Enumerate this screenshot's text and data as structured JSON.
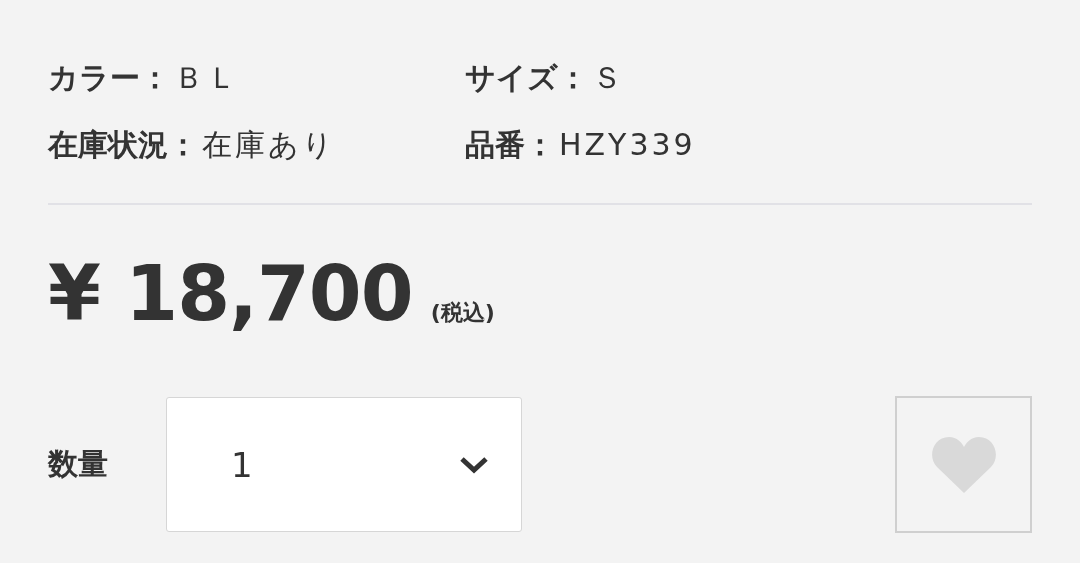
{
  "details": [
    {
      "label": "カラー：",
      "value": "ＢＬ"
    },
    {
      "label": "サイズ：",
      "value": "Ｓ"
    },
    {
      "label": "在庫状況：",
      "value": "在庫あり"
    },
    {
      "label": "品番：",
      "value": "HZY339"
    }
  ],
  "price": {
    "amount": "¥ 18,700",
    "tax_note": "(税込)"
  },
  "quantity": {
    "label": "数量",
    "value": "1"
  }
}
